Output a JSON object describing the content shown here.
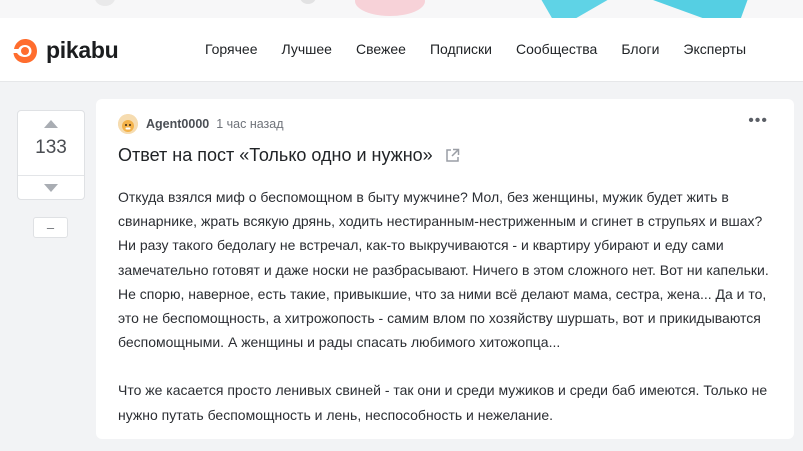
{
  "brand": {
    "name": "pikabu",
    "accent": "#ff6d2e"
  },
  "nav": [
    {
      "label": "Горячее"
    },
    {
      "label": "Лучшее"
    },
    {
      "label": "Свежее"
    },
    {
      "label": "Подписки"
    },
    {
      "label": "Сообщества"
    },
    {
      "label": "Блоги"
    },
    {
      "label": "Эксперты"
    }
  ],
  "vote": {
    "rating": "133",
    "collapse_label": "–"
  },
  "story": {
    "author": "Agent0000",
    "time": "1 час назад",
    "more_label": "•••",
    "title": "Ответ на пост «Только одно и нужно»",
    "paragraphs": [
      "Откуда взялся миф о беспомощном в быту мужчине? Мол, без женщины, мужик будет жить в свинарнике, жрать всякую дрянь, ходить нестиранным-нестриженным и сгинет в струпьях и вшах? Ни разу такого бедолагу не встречал, как-то выкручиваются - и квартиру убирают и еду сами замечательно готовят и даже носки не разбрасывают. Ничего в этом сложного нет. Вот ни капельки. Не спорю, наверное, есть такие, привыкшие, что за ними всё делают мама, сестра, жена... Да и то, это не беспомощность, а хитрожопость - самим влом по хозяйству шуршать, вот и прикидываются беспомощными. А женщины и рады спасать любимого хитожопца...",
      "Что же касается просто ленивых свиней - так они и среди мужиков и среди баб имеются. Только не нужно путать беспомощность и лень, неспособность и нежелание."
    ]
  }
}
